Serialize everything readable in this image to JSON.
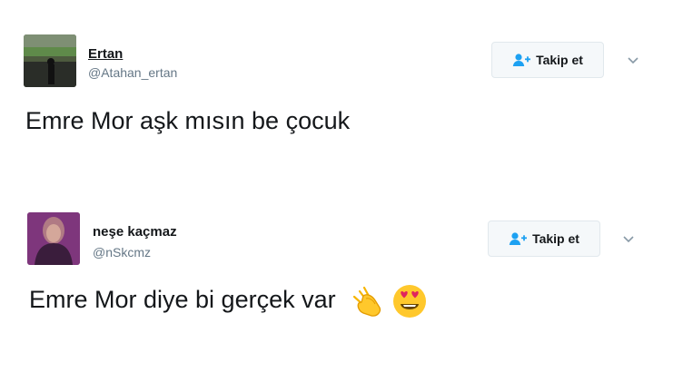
{
  "tweets": [
    {
      "display_name": "Ertan",
      "handle": "@Atahan_ertan",
      "follow_label": "Takip et",
      "text": "Emre Mor aşk mısın be çocuk",
      "emojis": []
    },
    {
      "display_name": "neşe kaçmaz",
      "handle": "@nSkcmz",
      "follow_label": "Takip et",
      "text": "Emre Mor diye bi gerçek var",
      "emojis": [
        "clapping-hands-icon",
        "heart-eyes-face-icon"
      ]
    }
  ],
  "colors": {
    "accent_blue": "#1da1f2",
    "handle_gray": "#657786",
    "button_bg": "#f5f8fa",
    "button_border": "#e1e8ed"
  }
}
